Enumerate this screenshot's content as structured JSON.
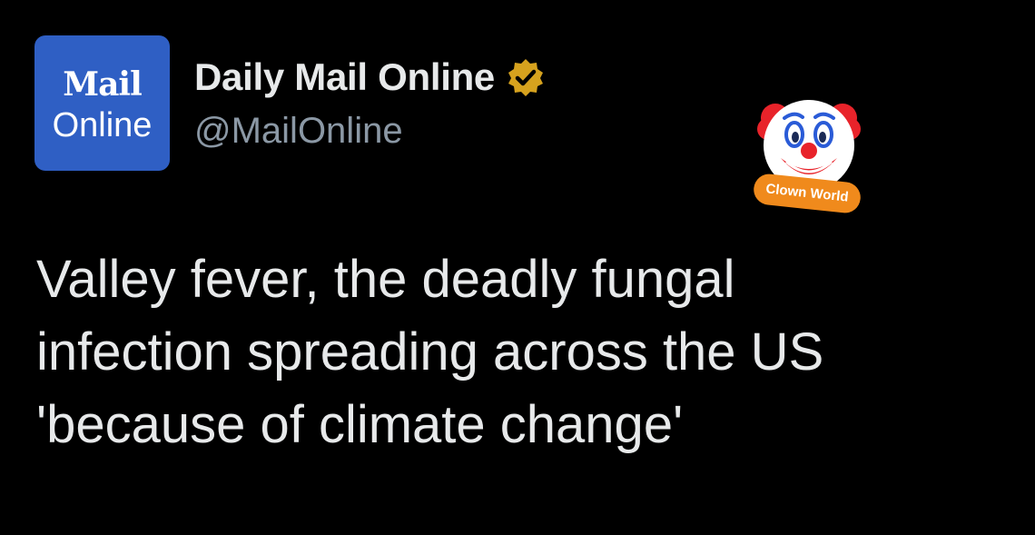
{
  "account": {
    "avatar_line1": "Mail",
    "avatar_line2": "Online",
    "display_name": "Daily Mail Online",
    "handle": "@MailOnline",
    "verified_icon": "verified-badge-icon",
    "avatar_color": "#2f5fc4",
    "badge_color": "#d6a21e"
  },
  "tweet": {
    "text": "Valley fever, the deadly fungal\ninfection spreading across the US\n'because of climate change'"
  },
  "sticker": {
    "icon": "clown-face-icon",
    "label": "Clown World",
    "label_color": "#f08a1c"
  },
  "colors": {
    "background": "#000000",
    "primary_text": "#e7e9ea",
    "secondary_text": "#8b98a5"
  }
}
